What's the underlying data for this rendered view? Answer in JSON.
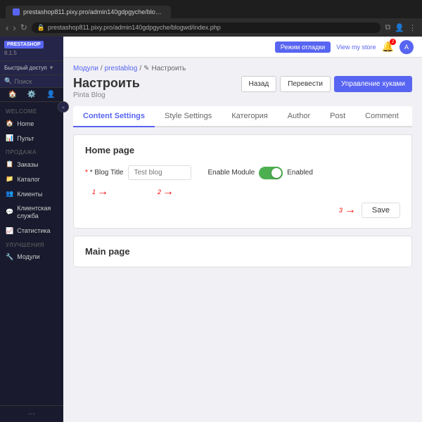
{
  "browser": {
    "tab_label": "prestashop811.pixy.pro/admin140gdpgyche/blogwd/index.php",
    "address": "prestashop811.pixy.pro/admin140gdpgyche/blogwd/index.php",
    "nav_back": "‹",
    "nav_forward": "›",
    "nav_refresh": "↻"
  },
  "sidebar": {
    "logo": "PRESTASHOP",
    "version": "8.1.5",
    "quick_access_label": "Быстрый доступ",
    "search_placeholder": "Поиск",
    "welcome_section": "WELCOME",
    "items_welcome": [
      {
        "label": "Home",
        "icon": "🏠"
      },
      {
        "label": "Пульт",
        "icon": "📊"
      }
    ],
    "sales_section": "ПРОДАЖА",
    "items_sales": [
      {
        "label": "Заказы",
        "icon": "📋"
      },
      {
        "label": "Каталог",
        "icon": "📁"
      },
      {
        "label": "Клиенты",
        "icon": "👥"
      },
      {
        "label": "Клиентская служба",
        "icon": "💬"
      },
      {
        "label": "Статистика",
        "icon": "📈"
      }
    ],
    "improve_section": "УЛУЧШЕНИЯ",
    "items_improve": [
      {
        "label": "Модули",
        "icon": "🔧"
      }
    ],
    "collapse_icon": "«"
  },
  "topbar": {
    "mode_btn": "Режим отладки",
    "view_store_link": "View my store",
    "bell_count": "2"
  },
  "breadcrumb": {
    "items": [
      "Модули",
      "prestablog",
      "Настроить"
    ]
  },
  "page": {
    "title": "Настроить",
    "subtitle": "Pinta Blog",
    "btn_back": "Назад",
    "btn_translate": "Перевести",
    "btn_manage": "Управление хуками"
  },
  "tabs": [
    {
      "label": "Content Settings",
      "active": true
    },
    {
      "label": "Style Settings"
    },
    {
      "label": "Категория"
    },
    {
      "label": "Author"
    },
    {
      "label": "Post"
    },
    {
      "label": "Comment"
    }
  ],
  "home_page_card": {
    "title": "Home page",
    "blog_title_label": "* Blog Title",
    "blog_title_placeholder": "Test blog",
    "enable_module_label": "Enable Module",
    "toggle_status": "Enabled",
    "annotation_1": "1",
    "annotation_2": "2",
    "annotation_3": "3",
    "save_btn": "Save"
  },
  "main_page_card": {
    "title": "Main page"
  }
}
